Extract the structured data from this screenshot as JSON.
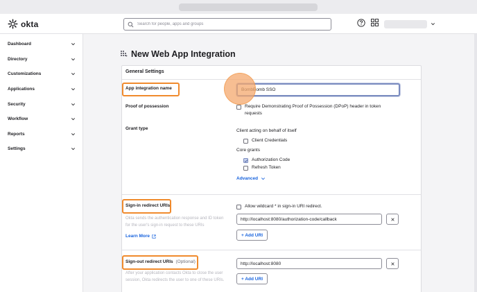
{
  "app": {
    "logo_text": "okta"
  },
  "header": {
    "search_placeholder": "Search for people, apps and groups",
    "icons": [
      "help-icon",
      "apps-grid-icon",
      "chevron-down-icon"
    ]
  },
  "sidebar": {
    "items": [
      {
        "label": "Dashboard"
      },
      {
        "label": "Directory"
      },
      {
        "label": "Customizations"
      },
      {
        "label": "Applications"
      },
      {
        "label": "Security"
      },
      {
        "label": "Workflow"
      },
      {
        "label": "Reports"
      },
      {
        "label": "Settings"
      }
    ]
  },
  "page": {
    "title": "New Web App Integration",
    "section_title": "General Settings",
    "app_name": {
      "label": "App integration name",
      "value": "BombBomb SSO"
    },
    "proof": {
      "label": "Proof of possession",
      "option": "Require Demonstrating Proof of Possession (DPoP) header in token requests"
    },
    "grant": {
      "label": "Grant type",
      "client_heading": "Client acting on behalf of itself",
      "client_credentials": "Client Credentials",
      "core_heading": "Core grants",
      "authorization_code": "Authorization Code",
      "refresh_token": "Refresh Token",
      "advanced": "Advanced"
    },
    "signin": {
      "label": "Sign-in redirect URIs",
      "help": "Okta sends the authentication response and ID token for the user's sign-in request to these URIs",
      "learn_more": "Learn More",
      "wildcard": "Allow wildcard * in sign-in URI redirect.",
      "uri_value": "http://localhost:8080/authorization-code/callback",
      "add_uri": "+ Add URI"
    },
    "signout": {
      "label": "Sign-out redirect URIs",
      "optional": "(Optional)",
      "help": "After your application contacts Okta to close the user session, Okta redirects the user to one of these URIs.",
      "uri_value": "http://localhost:8080",
      "add_uri": "+ Add URI"
    }
  },
  "colors": {
    "accent_blue": "#1662dd",
    "highlight_orange": "#f08a2c",
    "checked_fill": "#c7d2ee"
  }
}
